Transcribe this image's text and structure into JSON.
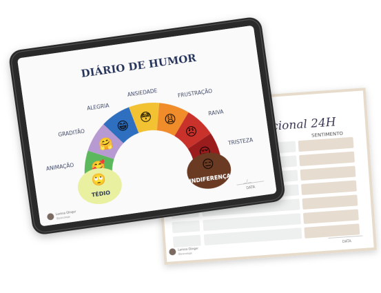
{
  "tablet": {
    "title": "DIÁRIO DE HUMOR",
    "moods": [
      {
        "label": "TÉDIO",
        "emoji": "🙄",
        "color": "#e9f0a0"
      },
      {
        "label": "ANIMAÇÃO",
        "emoji": "🥰",
        "color": "#5cb85c"
      },
      {
        "label": "GRADITÃO",
        "emoji": "🤗",
        "color": "#b79ad1"
      },
      {
        "label": "ALEGRIA",
        "emoji": "😁",
        "color": "#2d6fbf"
      },
      {
        "label": "ANSIEDADE",
        "emoji": "😳",
        "color": "#f2c230"
      },
      {
        "label": "FRUSTRAÇÃO",
        "emoji": "😩",
        "color": "#f08c2a"
      },
      {
        "label": "RAIVA",
        "emoji": "😠",
        "color": "#c9302c"
      },
      {
        "label": "TRISTEZA",
        "emoji": "😔",
        "color": "#9b1b1b"
      },
      {
        "label": "INDIFERENÇA",
        "emoji": "😑",
        "color": "#6b3a22"
      }
    ],
    "date_label": "DATA",
    "date_value": "__/__",
    "author": "Larissa Glinger",
    "handle": "@psicologa"
  },
  "sheet": {
    "title": "nocional 24H",
    "col_left": "O",
    "col_right": "SENTIMENTO",
    "date_label": "DATA",
    "author": "Larissa Glinger",
    "handle": "@psicologa"
  }
}
